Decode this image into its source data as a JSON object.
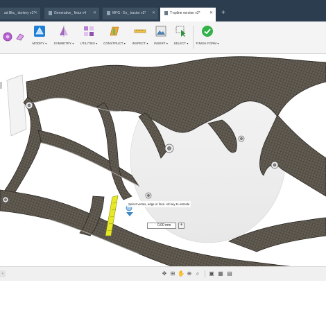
{
  "tabs": [
    {
      "label": "ad Bkc_ donkey v1*",
      "active": false
    },
    {
      "label": "Generative_ fixtur v4",
      "active": false
    },
    {
      "label": "MFG - Ex_ tractor v2*",
      "active": false
    },
    {
      "label": "T-spline version v2*",
      "active": true
    }
  ],
  "toolbar": {
    "modify": "MODIFY",
    "symmetry": "SYMMETRY",
    "utilities": "UTILITIES",
    "construct": "CONSTRUCT",
    "inspect": "INSPECT",
    "insert": "INSERT",
    "select": "SELECT",
    "finish_form": "FINISH FORM"
  },
  "viewport": {
    "hint": "Select vertex, edge or face. Alt key to extrude",
    "distance_value": "0.00 mm"
  },
  "colors": {
    "tab_bar": "#2c3d4f",
    "active_tab": "#ffffff",
    "finish_form_accent": "#33b249",
    "mesh_base": "#5d574d",
    "selection_highlight": "#e6e829"
  },
  "icons": {
    "modify": "modify-icon",
    "symmetry": "symmetry-icon",
    "utilities": "utilities-icon",
    "construct": "construct-icon",
    "inspect": "inspect-icon",
    "insert": "insert-icon",
    "select": "select-icon",
    "finish_form": "check-circle-icon"
  }
}
